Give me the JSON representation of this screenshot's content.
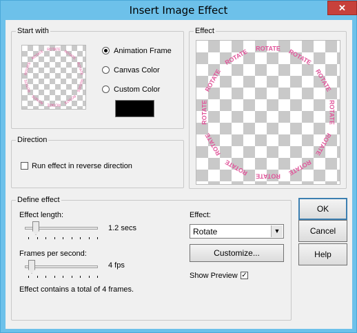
{
  "window": {
    "title": "Insert Image Effect",
    "close_glyph": "✕"
  },
  "start_with": {
    "legend": "Start with",
    "options": [
      "Animation Frame",
      "Canvas Color",
      "Custom Color"
    ],
    "selected": "Animation Frame",
    "custom_color": "#000000"
  },
  "effect_preview": {
    "legend": "Effect",
    "ring_text": "ROTATE",
    "ring_color": "#e0559a"
  },
  "direction": {
    "legend": "Direction",
    "reverse_label": "Run effect in reverse direction",
    "reverse_checked": false
  },
  "define": {
    "legend": "Define effect",
    "length_label": "Effect length:",
    "length_value": "1.2 secs",
    "fps_label": "Frames per second:",
    "fps_value": "4 fps",
    "summary": "Effect contains a total of 4 frames.",
    "effect_label": "Effect:",
    "effect_selected": "Rotate",
    "customize_label": "Customize...",
    "show_preview_label": "Show Preview",
    "show_preview_checked": true
  },
  "buttons": {
    "ok": "OK",
    "cancel": "Cancel",
    "help": "Help"
  }
}
